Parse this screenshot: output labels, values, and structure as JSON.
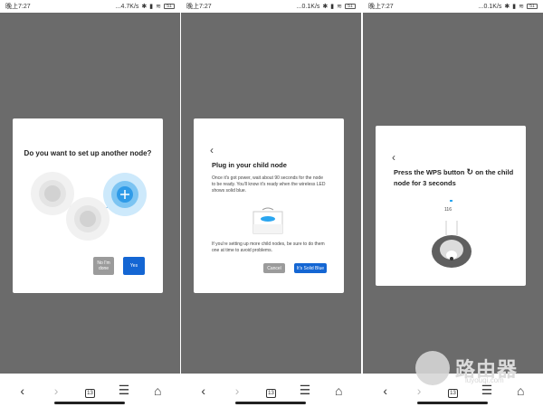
{
  "panels": [
    {
      "status": {
        "time": "晚上7:27",
        "speed": "...4.7K/s",
        "battery": "51"
      },
      "dialog": {
        "title": "Do you want to set up another node?",
        "no_button": "No I'm done",
        "yes_button": "Yes"
      }
    },
    {
      "status": {
        "time": "晚上7:27",
        "speed": "...0.1K/s",
        "battery": "51"
      },
      "dialog": {
        "title": "Plug in your child node",
        "para1": "Once it's got power, wait about 90 seconds for the node to be ready. You'll know it's ready when the wireless LED shows solid blue.",
        "para2": "If you're setting up more child nodes, be sure to do them one at time to avoid problems.",
        "cancel_button": "Cancel",
        "solid_blue_button": "It's Solid Blue"
      }
    },
    {
      "status": {
        "time": "晚上7:27",
        "speed": "...0.1K/s",
        "battery": "51"
      },
      "dialog": {
        "title_part1": "Press the WPS button",
        "title_part2": "on the child node for 3 seconds",
        "counter": "116"
      }
    }
  ],
  "nav": {
    "tab_count": "13"
  },
  "watermark": {
    "brand": "路由器",
    "site": "luyouqi.com"
  },
  "colors": {
    "accent": "#1466d3",
    "overlay": "#6b6b6b",
    "secondary_button": "#9b9b9b"
  },
  "icons": [
    "back-icon",
    "forward-icon",
    "tabs-icon",
    "menu-icon",
    "home-icon",
    "plus-icon",
    "wps-icon",
    "wifi-icon",
    "bluetooth-icon"
  ]
}
